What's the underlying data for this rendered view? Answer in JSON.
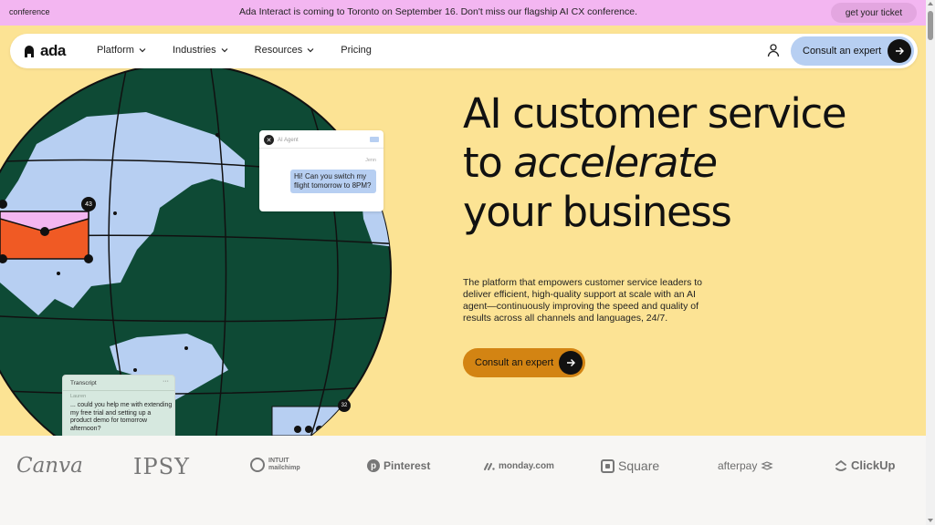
{
  "announcement": {
    "tag": "conference",
    "message": "Ada Interact is coming to Toronto on September 16. Don't miss our flagship AI CX conference.",
    "button": "get your ticket"
  },
  "nav": {
    "logo": "ada",
    "items": [
      {
        "label": "Platform",
        "has_dropdown": true
      },
      {
        "label": "Industries",
        "has_dropdown": true
      },
      {
        "label": "Resources",
        "has_dropdown": true
      },
      {
        "label": "Pricing",
        "has_dropdown": false
      }
    ],
    "user_icon": "user-icon",
    "cta": "Consult an expert"
  },
  "hero": {
    "headline_line1": "AI customer service",
    "headline_line2_prefix": "to ",
    "headline_line2_em": "accelerate",
    "headline_line3": "your business",
    "subtext": "The platform that empowers customer service leaders to deliver efficient, high-quality support at scale with an AI agent—continuously improving the speed and quality of results across all channels and languages, 24/7.",
    "cta": "Consult an expert"
  },
  "illustration": {
    "chat": {
      "agent_label": "AI Agent",
      "who": "Jenn",
      "message": "Hi! Can you switch my flight tomorrow to 8PM?"
    },
    "transcript": {
      "title": "Transcript",
      "dots": "···",
      "who": "Lauren",
      "message": "... could you help me with extending my free trial and setting up a product demo for tomorrow afternoon?"
    },
    "badges": [
      "43",
      "32"
    ]
  },
  "logos": [
    "Canva",
    "IPSY",
    "INTUIT mailchimp",
    "Pinterest",
    "monday.com",
    "Square",
    "afterpay",
    "ClickUp"
  ],
  "colors": {
    "announce_bg": "#f3b6f1",
    "hero_bg": "#fce394",
    "globe_green": "#0e4a35",
    "land_blue": "#b7cff2",
    "nav_cta": "#b7cff2",
    "hero_cta": "#d38413",
    "envelope": "#f05a24",
    "envelope_flap": "#f3b6f1"
  }
}
